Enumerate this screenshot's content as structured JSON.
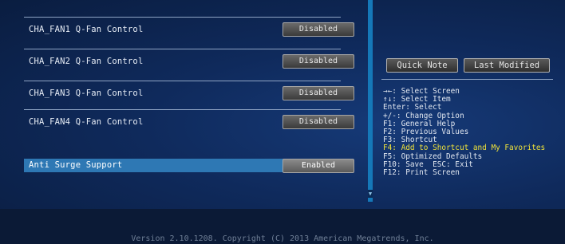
{
  "rows": [
    {
      "label": "CHA_FAN1 Q-Fan Control",
      "value": "Disabled"
    },
    {
      "label": "CHA_FAN2 Q-Fan Control",
      "value": "Disabled"
    },
    {
      "label": "CHA_FAN3 Q-Fan Control",
      "value": "Disabled"
    },
    {
      "label": "CHA_FAN4 Q-Fan Control",
      "value": "Disabled"
    },
    {
      "label": "Anti Surge Support",
      "value": "Enabled"
    }
  ],
  "buttons": {
    "quick_note": "Quick Note",
    "last_modified": "Last Modified"
  },
  "help": [
    "→←: Select Screen",
    "↑↓: Select Item",
    "Enter: Select",
    "+/-: Change Option",
    "F1: General Help",
    "F2: Previous Values",
    "F3: Shortcut",
    "F4: Add to Shortcut and My Favorites",
    "F5: Optimized Defaults",
    "F10: Save  ESC: Exit",
    "F12: Print Screen"
  ],
  "colors": {
    "highlight": "#f0e33a",
    "selected_row": "#2e78b4",
    "scrollbar": "#1578b8"
  },
  "footer": "Version 2.10.1208. Copyright (C) 2013 American Megatrends, Inc."
}
